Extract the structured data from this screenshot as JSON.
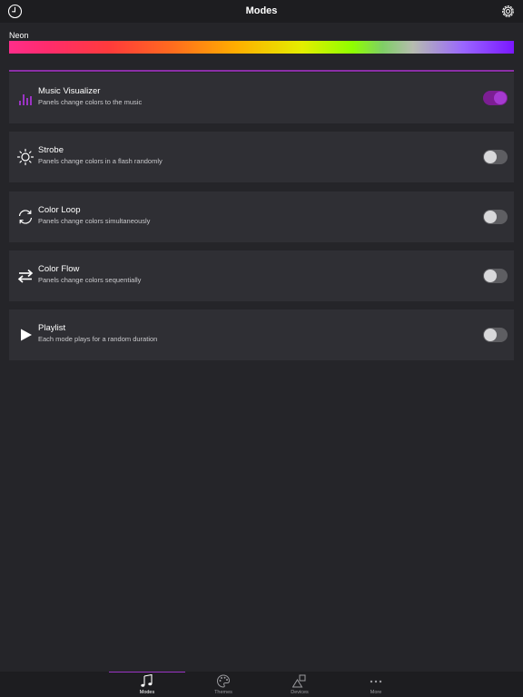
{
  "header": {
    "title": "Modes",
    "left_icon": "clock-icon",
    "right_icon": "gear-icon"
  },
  "theme": {
    "name": "Neon"
  },
  "colors": {
    "accent": "#9b34c4",
    "toggle_on": "#a53ad0"
  },
  "modes": [
    {
      "title": "Music Visualizer",
      "description": "Panels change colors to the music",
      "icon": "equalizer-icon",
      "enabled": true
    },
    {
      "title": "Strobe",
      "description": "Panels change colors in a flash randomly",
      "icon": "sun-icon",
      "enabled": false
    },
    {
      "title": "Color Loop",
      "description": "Panels change colors simultaneously",
      "icon": "loop-icon",
      "enabled": false
    },
    {
      "title": "Color Flow",
      "description": "Panels change colors sequentially",
      "icon": "swap-arrows-icon",
      "enabled": false
    },
    {
      "title": "Playlist",
      "description": "Each mode plays for a random duration",
      "icon": "play-icon",
      "enabled": false
    }
  ],
  "tabs": [
    {
      "label": "Modes",
      "icon": "music-note-icon",
      "active": true
    },
    {
      "label": "Themes",
      "icon": "palette-icon",
      "active": false
    },
    {
      "label": "Devices",
      "icon": "shapes-icon",
      "active": false
    },
    {
      "label": "More",
      "icon": "more-dots-icon",
      "active": false
    }
  ]
}
